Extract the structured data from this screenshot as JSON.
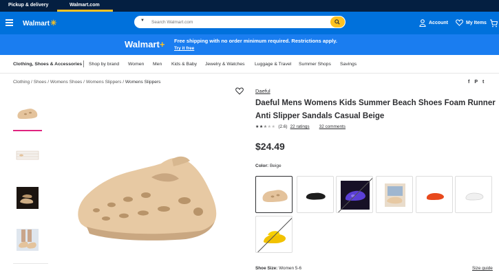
{
  "topbar": {
    "pickup": "Pickup & delivery",
    "walmart_com": "Walmart.com"
  },
  "header": {
    "logo": "Walmart",
    "search": {
      "placeholder": "Search Walmart.com"
    },
    "account": "Account",
    "my_items": "My Items"
  },
  "promo": {
    "logo": "Walmart",
    "plus": "+",
    "text": "Free shipping with no order minimum required. Restrictions apply.",
    "link": "Try it free"
  },
  "catnav": [
    "Clothing, Shoes & Accessories",
    "Shop by brand",
    "Women",
    "Men",
    "Kids & Baby",
    "Jewelry & Watches",
    "Luggage & Travel",
    "Summer Shops",
    "Savings"
  ],
  "breadcrumb": [
    "Clothing",
    "Shoes",
    "Womens Shoes",
    "Womens Slippers",
    "Womens Slippers"
  ],
  "product": {
    "brand": "Daeful",
    "title": "Daeful Mens Womens Kids Summer Beach Shoes Foam Runner Anti Slipper Sandals Casual Beige",
    "rating_value": "(2.6)",
    "rating_stars": 2.6,
    "ratings_link": "22 ratings",
    "comments_link": "32 comments",
    "price": "$24.49",
    "color_label": "Color:",
    "color_value": "Beige",
    "shoe_size_label": "Shoe Size:",
    "shoe_size_value": "Women 5-6",
    "size_guide": "Size guide"
  },
  "share": {
    "facebook": "f",
    "pinterest": "P",
    "twitter": "t"
  },
  "colors": {
    "brand_blue": "#0071dc",
    "dark_navy": "#041f41",
    "spark_yellow": "#ffc220",
    "active_pink": "#e0237f"
  }
}
